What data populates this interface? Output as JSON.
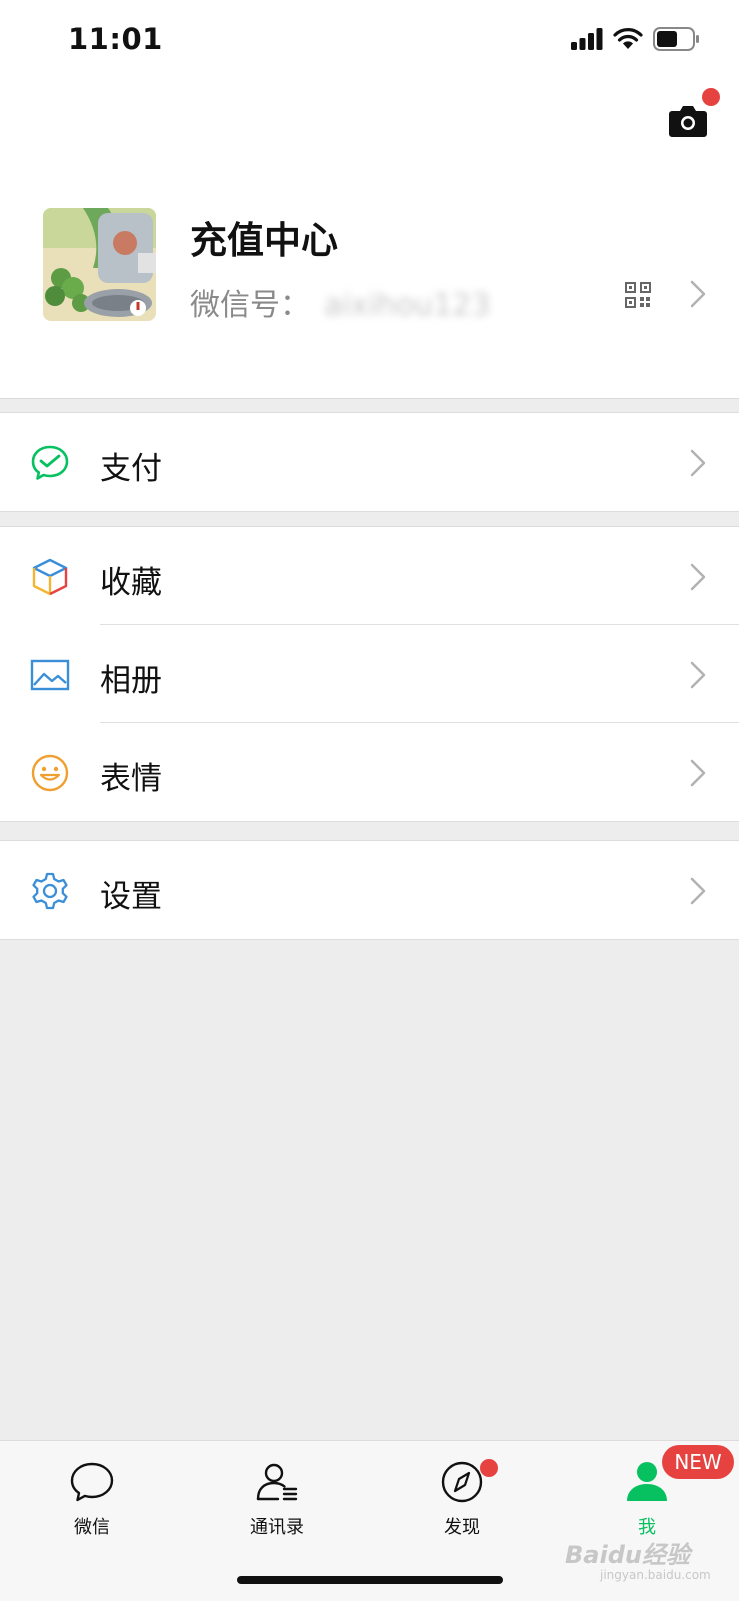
{
  "status_bar": {
    "time": "11:01"
  },
  "profile": {
    "name": "充值中心",
    "wechat_id_label": "微信号：",
    "wechat_id_value": "aixihou123"
  },
  "menu": {
    "pay": "支付",
    "favorites": "收藏",
    "album": "相册",
    "stickers": "表情",
    "settings": "设置"
  },
  "tabs": [
    {
      "label": "微信",
      "icon": "chat-bubble-icon"
    },
    {
      "label": "通讯录",
      "icon": "contacts-icon"
    },
    {
      "label": "发现",
      "icon": "compass-icon"
    },
    {
      "label": "我",
      "icon": "person-icon"
    }
  ],
  "badges": {
    "me_new": "NEW"
  },
  "watermark": {
    "text": "Baidu经验",
    "url": "jingyan.baidu.com"
  },
  "colors": {
    "brand_green": "#07c160",
    "badge_red": "#e64340",
    "background": "#ededed"
  }
}
